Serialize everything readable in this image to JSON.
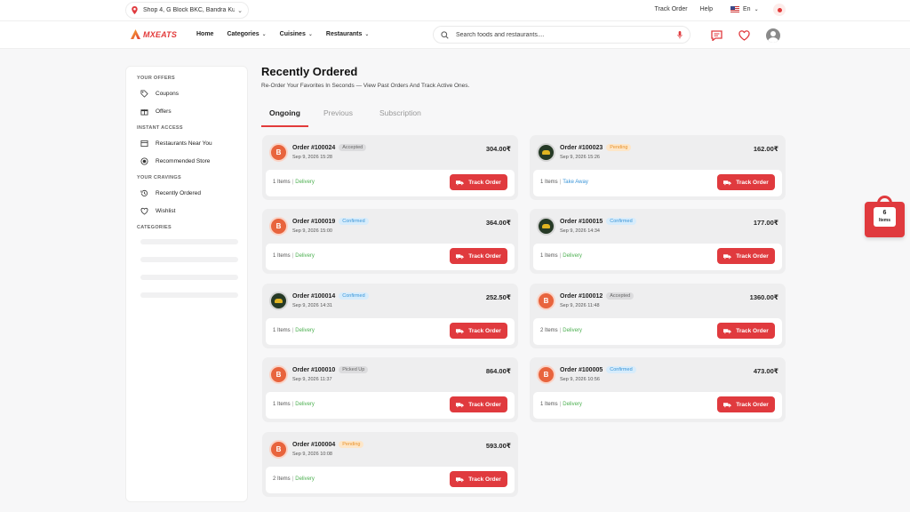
{
  "topbar": {
    "location": "Shop 4, G Block BKC, Bandra Ku...",
    "links": [
      "Track Order",
      "Help"
    ],
    "language": "En"
  },
  "nav": {
    "brand": "MXEATS",
    "menu": [
      {
        "label": "Home",
        "dropdown": false
      },
      {
        "label": "Categories",
        "dropdown": true
      },
      {
        "label": "Cuisines",
        "dropdown": true
      },
      {
        "label": "Restaurants",
        "dropdown": true
      }
    ],
    "search_placeholder": "Search foods and restaurants...."
  },
  "sidebar": {
    "sections": [
      {
        "title": "YOUR OFFERS",
        "items": [
          {
            "label": "Coupons",
            "icon": "tag-icon"
          },
          {
            "label": "Offers",
            "icon": "gift-icon"
          }
        ]
      },
      {
        "title": "INSTANT ACCESS",
        "items": [
          {
            "label": "Restaurants Near You",
            "icon": "store-icon"
          },
          {
            "label": "Recommended Store",
            "icon": "target-icon"
          }
        ]
      },
      {
        "title": "YOUR CRAVINGS",
        "items": [
          {
            "label": "Recently Ordered",
            "icon": "history-icon"
          },
          {
            "label": "Wishlist",
            "icon": "heart-icon"
          }
        ]
      },
      {
        "title": "CATEGORIES",
        "items": []
      }
    ]
  },
  "page": {
    "title": "Recently Ordered",
    "subtitle": "Re-Order Your Favorites In Seconds — View Past Orders And Track Active Ones.",
    "tabs": [
      "Ongoing",
      "Previous",
      "Subscription"
    ],
    "active_tab": "Ongoing"
  },
  "orders": [
    {
      "id": "Order #100024",
      "status": "Accepted",
      "status_class": "accepted",
      "date": "Sep 9, 2026 15:28",
      "amount": "304.00₹",
      "items": "1 Items",
      "mode": "Delivery",
      "avatar": "B"
    },
    {
      "id": "Order #100023",
      "status": "Pending",
      "status_class": "pending",
      "date": "Sep 9, 2026 15:26",
      "amount": "162.00₹",
      "items": "1 Items",
      "mode": "Take Away",
      "avatar": ""
    },
    {
      "id": "Order #100019",
      "status": "Confirmed",
      "status_class": "confirmed",
      "date": "Sep 9, 2026 15:00",
      "amount": "364.00₹",
      "items": "1 Items",
      "mode": "Delivery",
      "avatar": "B"
    },
    {
      "id": "Order #100015",
      "status": "Confirmed",
      "status_class": "confirmed",
      "date": "Sep 9, 2026 14:34",
      "amount": "177.00₹",
      "items": "1 Items",
      "mode": "Delivery",
      "avatar": ""
    },
    {
      "id": "Order #100014",
      "status": "Confirmed",
      "status_class": "confirmed",
      "date": "Sep 9, 2026 14:31",
      "amount": "252.50₹",
      "items": "1 Items",
      "mode": "Delivery",
      "avatar": ""
    },
    {
      "id": "Order #100012",
      "status": "Accepted",
      "status_class": "accepted",
      "date": "Sep 9, 2026 11:48",
      "amount": "1360.00₹",
      "items": "2 Items",
      "mode": "Delivery",
      "avatar": "B"
    },
    {
      "id": "Order #100010",
      "status": "Picked Up",
      "status_class": "picked",
      "date": "Sep 9, 2026 11:37",
      "amount": "864.00₹",
      "items": "1 Items",
      "mode": "Delivery",
      "avatar": "B"
    },
    {
      "id": "Order #100005",
      "status": "Confirmed",
      "status_class": "confirmed",
      "date": "Sep 9, 2026 10:56",
      "amount": "473.00₹",
      "items": "1 Items",
      "mode": "Delivery",
      "avatar": "B"
    },
    {
      "id": "Order #100004",
      "status": "Pending",
      "status_class": "pending",
      "date": "Sep 9, 2026 10:08",
      "amount": "593.00₹",
      "items": "2 Items",
      "mode": "Delivery",
      "avatar": "B"
    }
  ],
  "track_label": "Track Order",
  "cart": {
    "count": "6",
    "label": "Items"
  },
  "colors": {
    "accent": "#e03a3e",
    "delivery": "#4caf50",
    "takeaway": "#3a95d8"
  }
}
